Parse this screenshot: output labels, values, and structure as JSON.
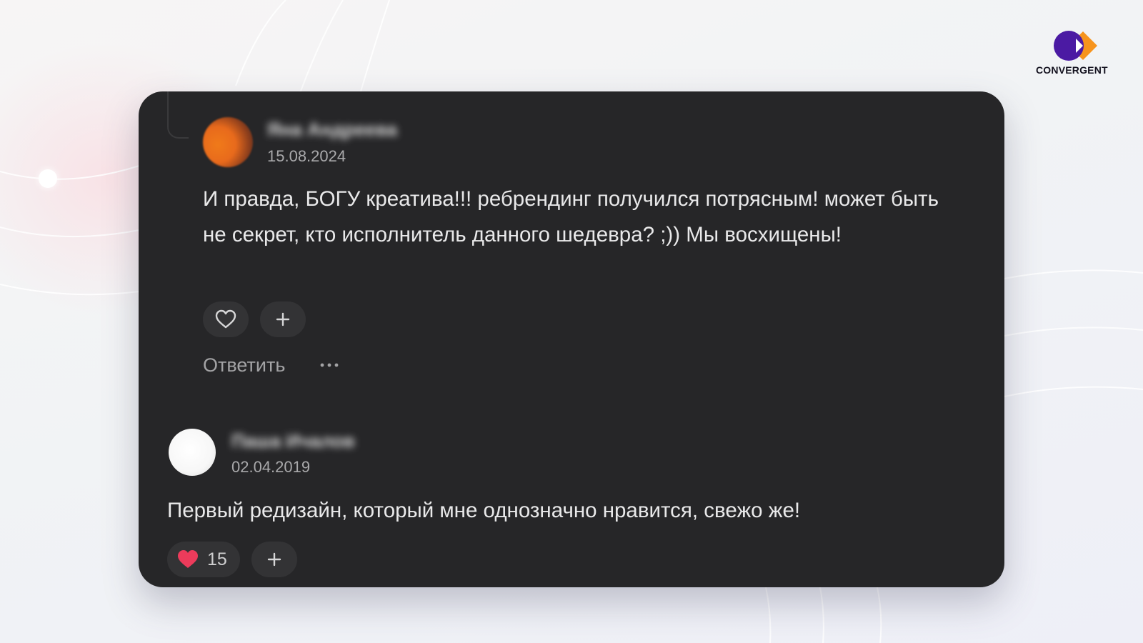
{
  "brand": {
    "logo_text": "CONVERGENT",
    "purple": "#4b1aa3",
    "orange": "#f7941d"
  },
  "comments": [
    {
      "author": "Яна Андреева",
      "date": "15.08.2024",
      "text": "И правда, БОГУ креатива!!! ребрендинг получился потрясным! может быть не секрет, кто исполнитель данного шедевра? ;)) Мы восхищены!",
      "like_icon": "heart-outline-icon",
      "reaction_icon": "plus-icon",
      "reply_label": "Ответить",
      "more_icon": "ellipsis-icon"
    },
    {
      "author": "Паша Ичалов",
      "date": "02.04.2019",
      "text": "Первый редизайн, который мне однозначно нравится, свежо же!",
      "like_icon": "heart-filled-icon",
      "like_count": "15",
      "reaction_icon": "plus-icon"
    }
  ],
  "colors": {
    "card_bg": "#262628",
    "pill_bg": "#333335",
    "heart_active": "#ec3b5b",
    "text_primary": "#e9e9ea",
    "text_secondary": "#a9a9ab"
  }
}
